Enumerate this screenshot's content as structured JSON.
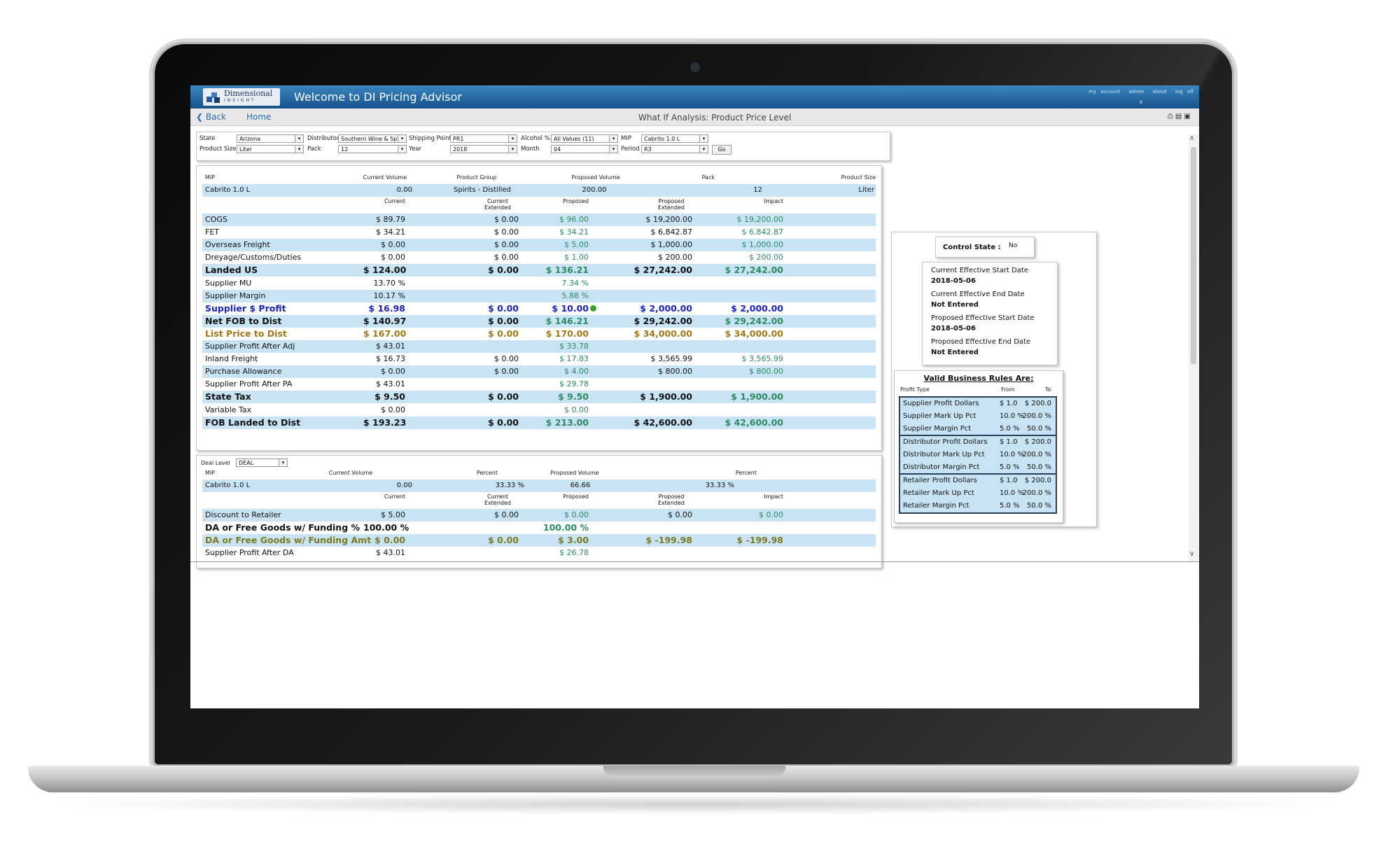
{
  "app": {
    "logo_top": "Dimensional",
    "logo_bottom": "INSIGHT",
    "title": "Welcome to DI Pricing Advisor",
    "links": [
      "my account",
      "admin",
      "about",
      "log off"
    ]
  },
  "nav": {
    "back": "Back",
    "home": "Home",
    "page_title": "What If Analysis: Product Price Level"
  },
  "filters": {
    "state_label": "State",
    "state": "Arizona",
    "distributor_label": "Distributor",
    "distributor": "Southern Wine & Spirits",
    "shipping_label": "Shipping Point",
    "shipping": "PR1",
    "alcohol_label": "Alcohol %",
    "alcohol": "All Values (11)",
    "mip_label": "MIP",
    "mip": "Cabrito 1.0 L",
    "size_label": "Product Size",
    "size": "Liter",
    "pack_label": "Pack",
    "pack": "12",
    "year_label": "Year",
    "year": "2018",
    "month_label": "Month",
    "month": "04",
    "period_label": "Period",
    "period": "R3",
    "go": "Go"
  },
  "top_table": {
    "summary_headers": [
      "MIP",
      "Current Volume",
      "Product Group",
      "Proposed Volume",
      "Pack",
      "Product Size"
    ],
    "summary_values": [
      "Cabrito 1.0 L",
      "0.00",
      "Spirits - Distilled",
      "200.00",
      "12",
      "Liter"
    ],
    "col_headers": [
      "Current",
      "Current Extended",
      "Proposed",
      "Proposed Extended",
      "Impact"
    ],
    "rows": [
      {
        "label": "COGS",
        "cur": "$ 89.79",
        "curext": "$ 0.00",
        "prop": "$ 96.00",
        "propext": "$ 19,200.00",
        "impact": "$ 19,200.00",
        "style": ""
      },
      {
        "label": "FET",
        "cur": "$ 34.21",
        "curext": "$ 0.00",
        "prop": "$ 34.21",
        "propext": "$ 6,842.87",
        "impact": "$ 6,842.87",
        "style": ""
      },
      {
        "label": "Overseas Freight",
        "cur": "$ 0.00",
        "curext": "$ 0.00",
        "prop": "$ 5.00",
        "propext": "$ 1,000.00",
        "impact": "$ 1,000.00",
        "style": ""
      },
      {
        "label": "Dreyage/Customs/Duties",
        "cur": "$ 0.00",
        "curext": "$ 0.00",
        "prop": "$ 1.00",
        "propext": "$ 200.00",
        "impact": "$ 200.00",
        "style": ""
      },
      {
        "label": "Landed US",
        "cur": "$ 124.00",
        "curext": "$ 0.00",
        "prop": "$ 136.21",
        "propext": "$ 27,242.00",
        "impact": "$ 27,242.00",
        "style": "bold"
      },
      {
        "label": "Supplier MU",
        "cur": "13.70 %",
        "curext": "",
        "prop": "7.34 %",
        "propext": "",
        "impact": "",
        "style": ""
      },
      {
        "label": "Supplier Margin",
        "cur": "10.17 %",
        "curext": "",
        "prop": "5.88 %",
        "propext": "",
        "impact": "",
        "style": ""
      },
      {
        "label": "Supplier $ Profit",
        "cur": "$ 16.98",
        "curext": "$ 0.00",
        "prop": "$ 10.00",
        "propext": "$ 2,000.00",
        "impact": "$ 2,000.00",
        "style": "blue"
      },
      {
        "label": "Net FOB to Dist",
        "cur": "$ 140.97",
        "curext": "$ 0.00",
        "prop": "$ 146.21",
        "propext": "$ 29,242.00",
        "impact": "$ 29,242.00",
        "style": "bold"
      },
      {
        "label": "List Price to Dist",
        "cur": "$ 167.00",
        "curext": "$ 0.00",
        "prop": "$ 170.00",
        "propext": "$ 34,000.00",
        "impact": "$ 34,000.00",
        "style": "gold"
      },
      {
        "label": "Supplier Profit After Adj",
        "cur": "$ 43.01",
        "curext": "",
        "prop": "$ 33.78",
        "propext": "",
        "impact": "",
        "style": ""
      },
      {
        "label": "Inland Freight",
        "cur": "$ 16.73",
        "curext": "$ 0.00",
        "prop": "$ 17.83",
        "propext": "$ 3,565.99",
        "impact": "$ 3,565.99",
        "style": ""
      },
      {
        "label": "Purchase Allowance",
        "cur": "$ 0.00",
        "curext": "$ 0.00",
        "prop": "$ 4.00",
        "propext": "$ 800.00",
        "impact": "$ 800.00",
        "style": ""
      },
      {
        "label": "Supplier Profit After PA",
        "cur": "$ 43.01",
        "curext": "",
        "prop": "$ 29.78",
        "propext": "",
        "impact": "",
        "style": ""
      },
      {
        "label": "State Tax",
        "cur": "$ 9.50",
        "curext": "$ 0.00",
        "prop": "$ 9.50",
        "propext": "$ 1,900.00",
        "impact": "$ 1,900.00",
        "style": "bold"
      },
      {
        "label": "Variable Tax",
        "cur": "$ 0.00",
        "curext": "",
        "prop": "$ 0.00",
        "propext": "",
        "impact": "",
        "style": ""
      },
      {
        "label": "FOB Landed to Dist",
        "cur": "$ 193.23",
        "curext": "$ 0.00",
        "prop": "$ 213.00",
        "propext": "$ 42,600.00",
        "impact": "$ 42,600.00",
        "style": "bold"
      }
    ]
  },
  "deal_table": {
    "deal_label": "Deal Level",
    "deal_value": "DEAL",
    "summary_headers": [
      "MIP",
      "Current Volume",
      "Percent",
      "Proposed Volume",
      "Percent"
    ],
    "summary_values": [
      "Cabrito 1.0 L",
      "0.00",
      "33.33 %",
      "66.66",
      "33.33 %"
    ],
    "col_headers": [
      "Current",
      "Current Extended",
      "Proposed",
      "Proposed Extended",
      "Impact"
    ],
    "rows": [
      {
        "label": "Discount to Retailer",
        "cur": "$ 5.00",
        "curext": "$ 0.00",
        "prop": "$ 0.00",
        "propext": "$ 0.00",
        "impact": "$ 0.00",
        "style": ""
      },
      {
        "label": "DA or Free Goods w/ Funding %",
        "cur": "100.00 %",
        "curext": "",
        "prop": "100.00 %",
        "propext": "",
        "impact": "",
        "style": "bold"
      },
      {
        "label": "DA or Free Goods w/ Funding Amt",
        "cur": "$ 0.00",
        "curext": "$ 0.00",
        "prop": "$ 3.00",
        "propext": "$ -199.98",
        "impact": "$ -199.98",
        "style": "olive"
      },
      {
        "label": "Supplier Profit After DA",
        "cur": "$ 43.01",
        "curext": "",
        "prop": "$ 26.78",
        "propext": "",
        "impact": "",
        "style": ""
      }
    ]
  },
  "control": {
    "label": "Control State :",
    "value": "No"
  },
  "dates": {
    "cur_start_label": "Current Effective Start Date",
    "cur_start": "2018-05-06",
    "cur_end_label": "Current Effective End Date",
    "cur_end": "Not Entered",
    "prop_start_label": "Proposed Effective Start Date",
    "prop_start": "2018-05-06",
    "prop_end_label": "Proposed Effective End Date",
    "prop_end": "Not Entered"
  },
  "rules": {
    "title": "Valid Business Rules Are:",
    "headers": [
      "Profit Type",
      "From",
      "To"
    ],
    "groups": [
      [
        [
          "Supplier Profit Dollars",
          "$ 1.0",
          "$ 200.0"
        ],
        [
          "Supplier Mark Up Pct",
          "10.0 %",
          "200.0 %"
        ],
        [
          "Supplier Margin Pct",
          "5.0 %",
          "50.0 %"
        ]
      ],
      [
        [
          "Distributor Profit Dollars",
          "$ 1.0",
          "$ 200.0"
        ],
        [
          "Distributor Mark Up Pct",
          "10.0 %",
          "200.0 %"
        ],
        [
          "Distributor Margin Pct",
          "5.0 %",
          "50.0 %"
        ]
      ],
      [
        [
          "Retailer Profit Dollars",
          "$ 1.0",
          "$ 200.0"
        ],
        [
          "Retailer Mark Up Pct",
          "10.0 %",
          "200.0 %"
        ],
        [
          "Retailer Margin Pct",
          "5.0 %",
          "50.0 %"
        ]
      ]
    ]
  },
  "colors": {
    "appbar": "#1f62a0",
    "row_blue": "#c8e3f3",
    "green": "#2b8a60",
    "blue": "#1a22c4",
    "gold": "#a07818"
  }
}
